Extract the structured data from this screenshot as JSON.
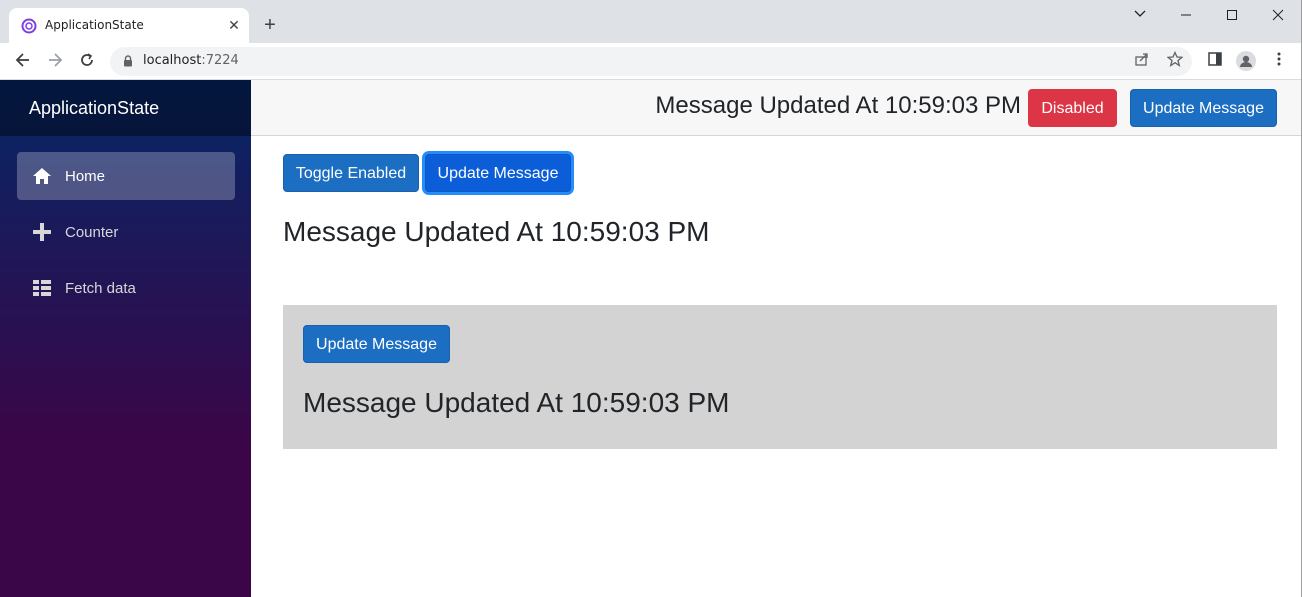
{
  "browser": {
    "tab_title": "ApplicationState",
    "new_tab": "+",
    "url_host": "localhost",
    "url_port": ":7224"
  },
  "sidebar": {
    "brand": "ApplicationState",
    "items": [
      {
        "label": "Home",
        "icon": "home-icon",
        "active": true
      },
      {
        "label": "Counter",
        "icon": "plus-icon",
        "active": false
      },
      {
        "label": "Fetch data",
        "icon": "list-icon",
        "active": false
      }
    ]
  },
  "top_row": {
    "message": "Message Updated At 10:59:03 PM",
    "disabled_label": "Disabled",
    "update_label": "Update Message"
  },
  "main": {
    "toggle_label": "Toggle Enabled",
    "update_label": "Update Message",
    "message": "Message Updated At 10:59:03 PM"
  },
  "panel": {
    "update_label": "Update Message",
    "message": "Message Updated At 10:59:03 PM"
  },
  "colors": {
    "primary": "#1b6ec2",
    "danger": "#dc3545",
    "panel_bg": "#d3d3d3",
    "sidebar_top": "#052767",
    "sidebar_bottom": "#3a0647"
  }
}
